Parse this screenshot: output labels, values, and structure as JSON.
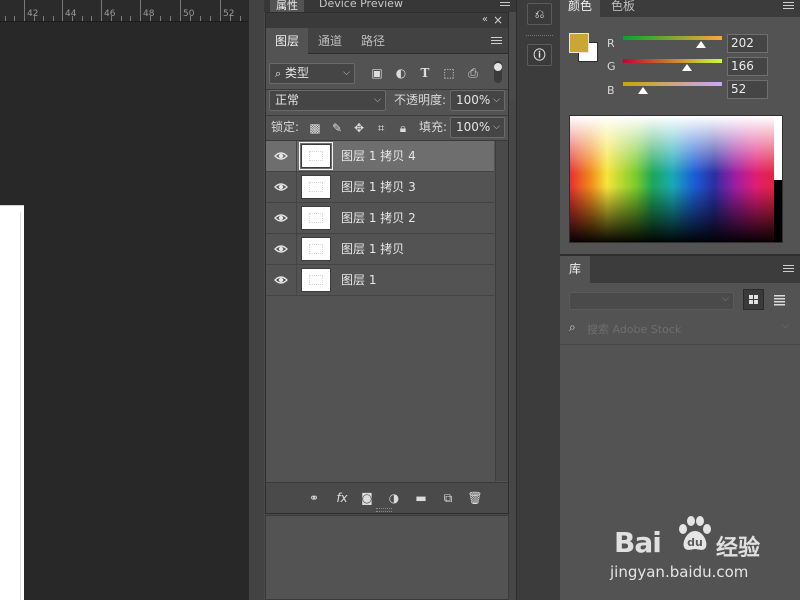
{
  "ruler": {
    "numbers": [
      "42",
      "44",
      "46",
      "48",
      "50",
      "52"
    ]
  },
  "properties_panel": {
    "tabs": [
      "属性",
      "Device Preview"
    ]
  },
  "layers_panel": {
    "tabs": [
      "图层",
      "通道",
      "路径"
    ],
    "filter": {
      "value": "类型"
    },
    "blend_mode": {
      "value": "正常"
    },
    "opacity": {
      "label": "不透明度:",
      "value": "100%"
    },
    "lock_label": "锁定:",
    "fill": {
      "label": "填充:",
      "value": "100%"
    },
    "layers": [
      {
        "name": "图层 1 拷贝 4",
        "selected": true,
        "visible": true
      },
      {
        "name": "图层 1 拷贝 3",
        "selected": false,
        "visible": true
      },
      {
        "name": "图层 1 拷贝 2",
        "selected": false,
        "visible": true
      },
      {
        "name": "图层 1 拷贝",
        "selected": false,
        "visible": true
      },
      {
        "name": "图层 1",
        "selected": false,
        "visible": true
      }
    ],
    "bottom_icons": [
      "link-icon",
      "fx-icon",
      "mask-icon",
      "adjustment-icon",
      "folder-icon",
      "new-layer-icon",
      "trash-icon"
    ],
    "fx_label": "fx"
  },
  "color_panel": {
    "tabs": [
      "颜色",
      "色板"
    ],
    "foreground_color": "#caa634",
    "background_color": "#ffffff",
    "channels": [
      {
        "label": "R",
        "value": "202"
      },
      {
        "label": "G",
        "value": "166"
      },
      {
        "label": "B",
        "value": "52"
      }
    ]
  },
  "libraries_panel": {
    "tab": "库",
    "search_placeholder": "搜索 Adobe Stock"
  },
  "watermark": {
    "brand": "Bai",
    "brand_suffix": "经验",
    "url": "jingyan.baidu.com"
  }
}
